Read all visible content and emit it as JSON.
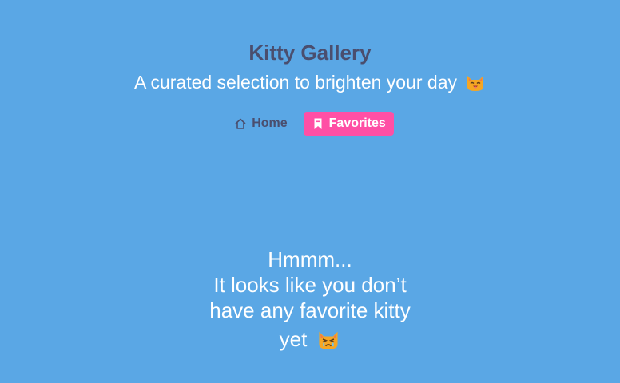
{
  "header": {
    "title": "Kitty Gallery",
    "subtitle": "A curated selection to brighten your day",
    "subtitle_emoji": "smiling-cat-icon"
  },
  "nav": {
    "items": [
      {
        "label": "Home",
        "icon": "home-icon",
        "active": false
      },
      {
        "label": "Favorites",
        "icon": "bookmark-icon",
        "active": true
      }
    ]
  },
  "empty_state": {
    "line1": "Hmmm...",
    "line2": "It looks like you don’t",
    "line3": "have any favorite kitty",
    "line4": "yet",
    "emoji": "crying-cat-icon"
  },
  "colors": {
    "background": "#5aa7e5",
    "title": "#4a4e6e",
    "active_nav": "#ff4fa5"
  }
}
